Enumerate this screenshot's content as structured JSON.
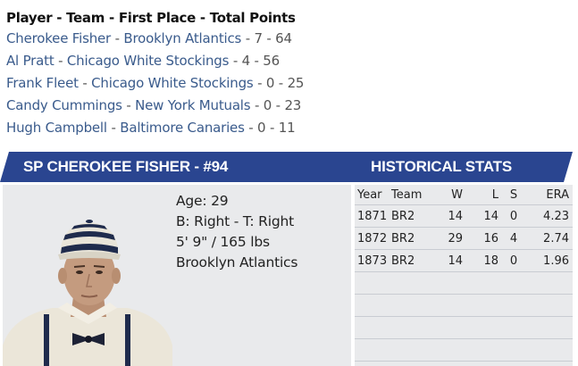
{
  "voting": {
    "header": "Player - Team - First Place - Total Points",
    "rows": [
      {
        "player": "Cherokee Fisher",
        "team": "Brooklyn Atlantics",
        "rest": " - 7 - 64"
      },
      {
        "player": "Al Pratt",
        "team": "Chicago White Stockings",
        "rest": " - 4 - 56"
      },
      {
        "player": "Frank Fleet",
        "team": "Chicago White Stockings",
        "rest": " - 0 - 25"
      },
      {
        "player": "Candy Cummings",
        "team": "New York Mutuals",
        "rest": " - 0 - 23"
      },
      {
        "player": "Hugh Campbell",
        "team": "Baltimore Canaries",
        "rest": " - 0 - 11"
      }
    ],
    "separator": " - "
  },
  "banner": {
    "player_title": "SP CHEROKEE FISHER - #94",
    "stats_title": "HISTORICAL STATS",
    "color": "#2a4590"
  },
  "bio": {
    "age": "Age: 29",
    "bats_throws": "B: Right - T: Right",
    "height_weight": "5' 9\" / 165 lbs",
    "team": "Brooklyn Atlantics",
    "portrait_icon": "player-portrait"
  },
  "stats": {
    "headers": {
      "year": "Year",
      "team": "Team",
      "w": "W",
      "l": "L",
      "s": "S",
      "era": "ERA"
    },
    "rows": [
      {
        "year": "1871",
        "team": "BR2",
        "w": "14",
        "l": "14",
        "s": "0",
        "era": "4.23"
      },
      {
        "year": "1872",
        "team": "BR2",
        "w": "29",
        "l": "16",
        "s": "4",
        "era": "2.74"
      },
      {
        "year": "1873",
        "team": "BR2",
        "w": "14",
        "l": "18",
        "s": "0",
        "era": "1.96"
      }
    ]
  }
}
